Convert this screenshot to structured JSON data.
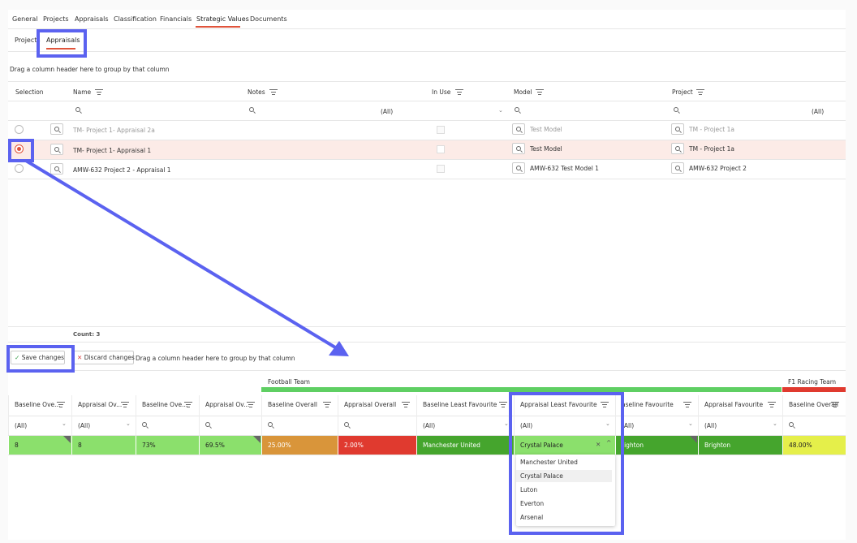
{
  "top_tabs": [
    "General",
    "Projects",
    "Appraisals",
    "Classification",
    "Financials",
    "Strategic Values",
    "Documents"
  ],
  "sub_tabs": [
    "Projects",
    "Appraisals"
  ],
  "group_hint": "Drag a column header here to group by that column",
  "grid1": {
    "columns": [
      "Selection",
      "Name",
      "Notes",
      "In Use",
      "Model",
      "Project"
    ],
    "all_filter": "(All)",
    "rows": [
      {
        "name": "TM- Project 1- Appraisal 2a",
        "model": "Test Model",
        "project": "TM - Project 1a",
        "selected": false
      },
      {
        "name": "TM- Project 1- Appraisal 1",
        "model": "Test Model",
        "project": "TM - Project 1a",
        "selected": true
      },
      {
        "name": "AMW-632 Project 2 - Appraisal 1",
        "model": "AMW-632 Test Model 1",
        "project": "AMW-632 Project 2",
        "selected": false
      }
    ],
    "count_label": "Count: 3"
  },
  "toolbar": {
    "save": "Save changes",
    "discard": "Discard changes"
  },
  "grid2": {
    "band_labels": [
      "Football Team",
      "F1 Racing Team"
    ],
    "band_colors": [
      "#5fcf63",
      "#e03a2f"
    ],
    "columns": [
      "Baseline Ove...",
      "Appraisal Ov...",
      "Baseline Ove...",
      "Appraisal Ov...",
      "Baseline Overall",
      "Appraisal Overall",
      "Baseline Least Favourite",
      "Appraisal Least Favourite",
      "aseline Favourite",
      "Appraisal Favourite",
      "Baseline Overall"
    ],
    "filters": [
      "(All)",
      "(All)",
      "",
      "",
      "",
      "",
      "(All)",
      "(All)",
      "(All)",
      "(All)",
      ""
    ],
    "values": [
      "8",
      "8",
      "73%",
      "69.5%",
      "25.00%",
      "2.00%",
      "Manchester United",
      "Crystal Palace",
      "righton",
      "Brighton",
      "48.00%"
    ],
    "cell_colors": [
      "#8be06c",
      "#8be06c",
      "#8be06c",
      "#8be06c",
      "#d9953a",
      "#e03a2f",
      "#45a52d",
      "#8be06c",
      "#45a52d",
      "#45a52d",
      "#e5ef4a"
    ]
  },
  "dropdown": {
    "options": [
      "Manchester United",
      "Crystal Palace",
      "Luton",
      "Everton",
      "Arsenal"
    ],
    "highlighted": "Crystal Palace"
  },
  "colors": {
    "accent": "#e0533b",
    "annotation": "#5b62f0",
    "selected_row": "#fcebe7"
  }
}
